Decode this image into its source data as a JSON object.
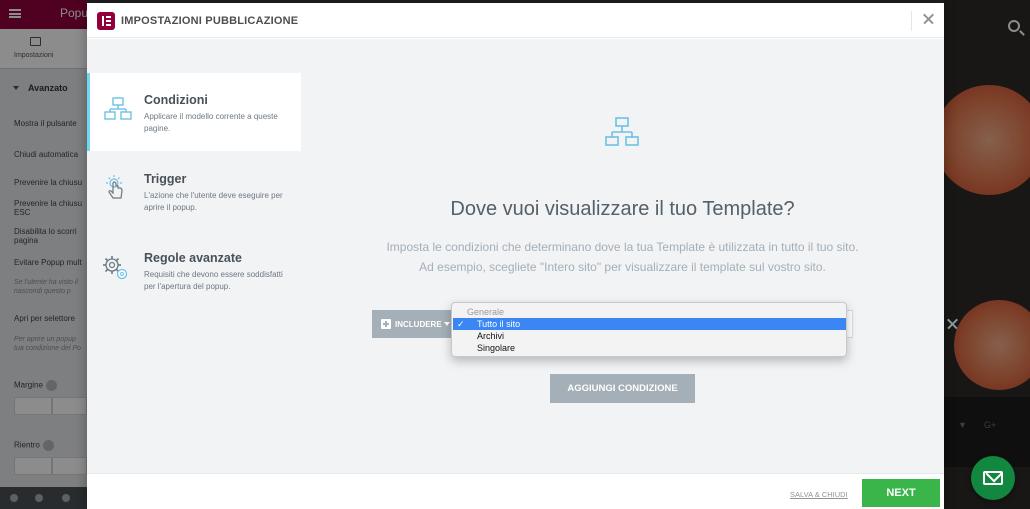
{
  "background": {
    "topbar_title": "Popu",
    "tab_label": "Impostazioni",
    "section": "Avanzato",
    "rows": [
      "Mostra il pulsante",
      "Chiudi automatica",
      "Prevenire la chiusu",
      "Prevenire la chiusu ESC",
      "Disabilita lo scorri pagina",
      "Evitare Popup mult",
      "Apri per selettore",
      "Margine",
      "Rientro"
    ],
    "hints": [
      "Se l'utente ha visto il nascondi questo p",
      "Per aprire un popup tua condizione del Po"
    ]
  },
  "modal": {
    "title": "IMPOSTAZIONI PUBBLICAZIONE",
    "tabs": [
      {
        "title": "Condizioni",
        "desc": "Applicare il modello corrente a queste pagine.",
        "icon": "sitemap-icon",
        "active": true
      },
      {
        "title": "Trigger",
        "desc": "L'azione che l'utente deve eseguire per aprire il popup.",
        "icon": "pointer-click-icon",
        "active": false
      },
      {
        "title": "Regole avanzate",
        "desc": "Requisiti che devono essere soddisfatti per l'apertura del popup.",
        "icon": "gears-icon",
        "active": false
      }
    ],
    "main": {
      "heading": "Dove vuoi visualizzare il tuo Template?",
      "desc_line1": "Imposta le condizioni che determinano dove la tua Template è utilizzata in tutto il tuo sito.",
      "desc_line2": "Ad esempio, scegliete \"Intero sito\" per visualizzare il template sul vostro sito.",
      "include_label": "INCLUDERE",
      "add_condition": "AGGIUNGI CONDIZIONE"
    },
    "dropdown": {
      "group": "Generale",
      "options": [
        "Tutto il sito",
        "Archivi",
        "Singolare"
      ],
      "selected": "Tutto il sito"
    },
    "footer": {
      "save_close": "SALVA & CHIUDI",
      "next": "NEXT"
    }
  },
  "colors": {
    "brand": "#92003b",
    "accent": "#71d7f7",
    "next_green": "#39b54a",
    "grey_button": "#a4afb7",
    "select_blue": "#3a86f5"
  }
}
